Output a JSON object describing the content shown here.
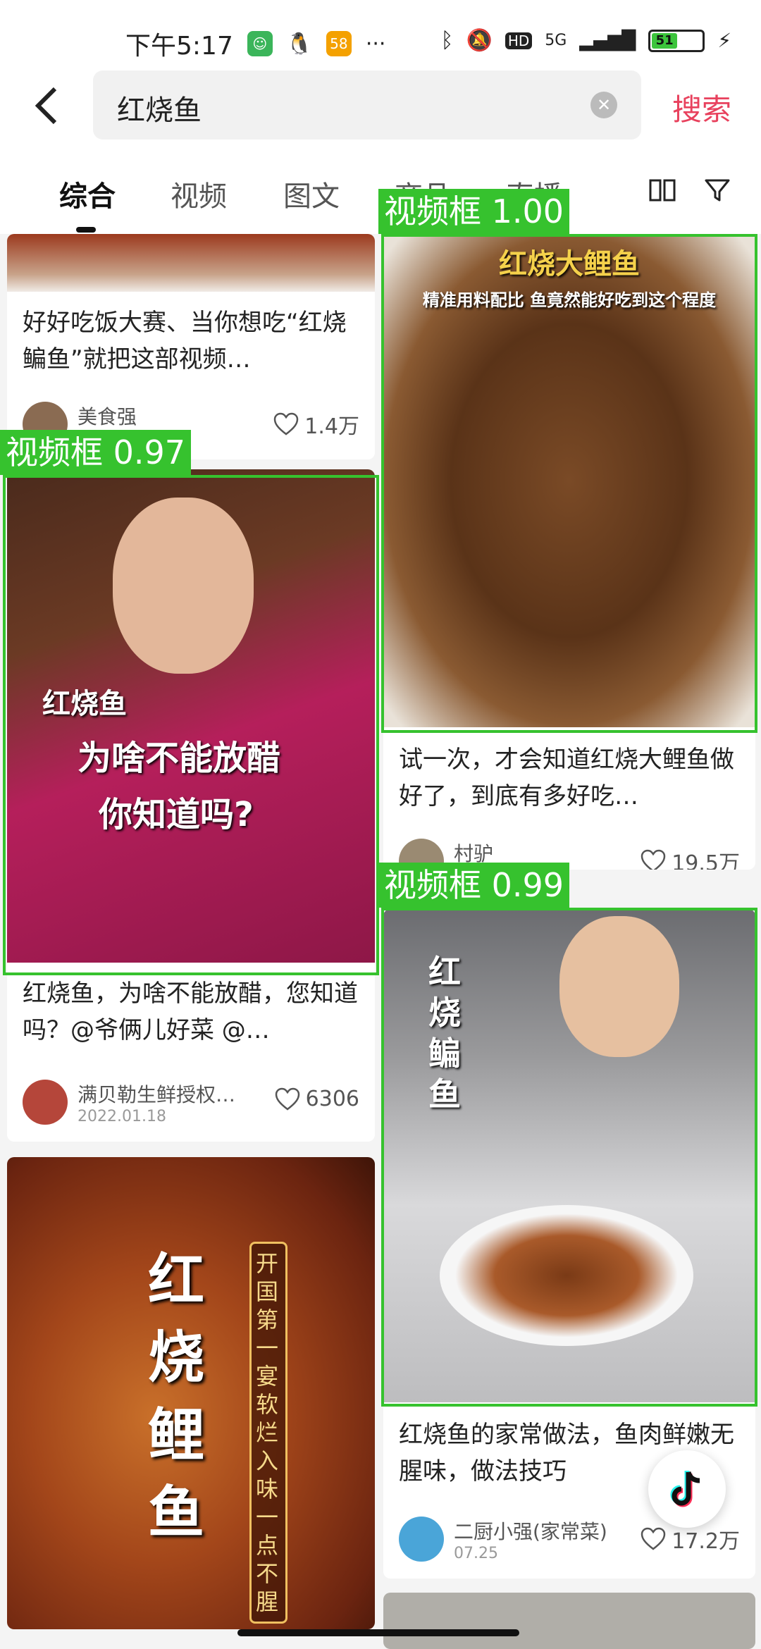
{
  "status_bar": {
    "time": "下午5:17",
    "network": "5G",
    "hd": "HD",
    "battery": "51"
  },
  "search": {
    "query": "红烧鱼",
    "button_label": "搜索"
  },
  "tabs": [
    {
      "label": "综合"
    },
    {
      "label": "视频"
    },
    {
      "label": "图文"
    },
    {
      "label": "商品"
    },
    {
      "label": "直播"
    }
  ],
  "cards": [
    {
      "title": "好好吃饭大赛、当你想吃“红烧鳊鱼”就把这部视频…",
      "author": "美食强",
      "likes": "1.4万"
    },
    {
      "title": "红烧鱼，为啥不能放醋，您知道吗？@爷俩儿好菜 @…",
      "author": "满贝勒生鲜授权…",
      "date": "2022.01.18",
      "likes": "6306",
      "overlay_lines": [
        "红烧鱼",
        "为啥不能放醋",
        "你知道吗?"
      ]
    },
    {
      "overlay_title": "红烧鲤鱼",
      "overlay_side": "开国第一宴 软烂入味一点不腥"
    },
    {
      "title": "试一次，才会知道红烧大鲤鱼做好了，到底有多好吃…",
      "author": "村驴",
      "likes": "19.5万",
      "overlay_title": "红烧大鲤鱼",
      "overlay_sub": "精准用料配比 鱼竟然能好吃到这个程度"
    },
    {
      "title": "红烧鱼的家常做法，鱼肉鲜嫩无腥味，做法技巧",
      "author": "二厨小强(家常菜)",
      "date": "07.25",
      "likes": "17.2万",
      "overlay_title": "红烧鳊鱼"
    }
  ],
  "detections": [
    {
      "label": "视频框 1.00"
    },
    {
      "label": "视频框 0.97"
    },
    {
      "label": "视频框 0.99"
    }
  ],
  "colors": {
    "accent": "#e8415d",
    "detection": "#36c22e"
  }
}
